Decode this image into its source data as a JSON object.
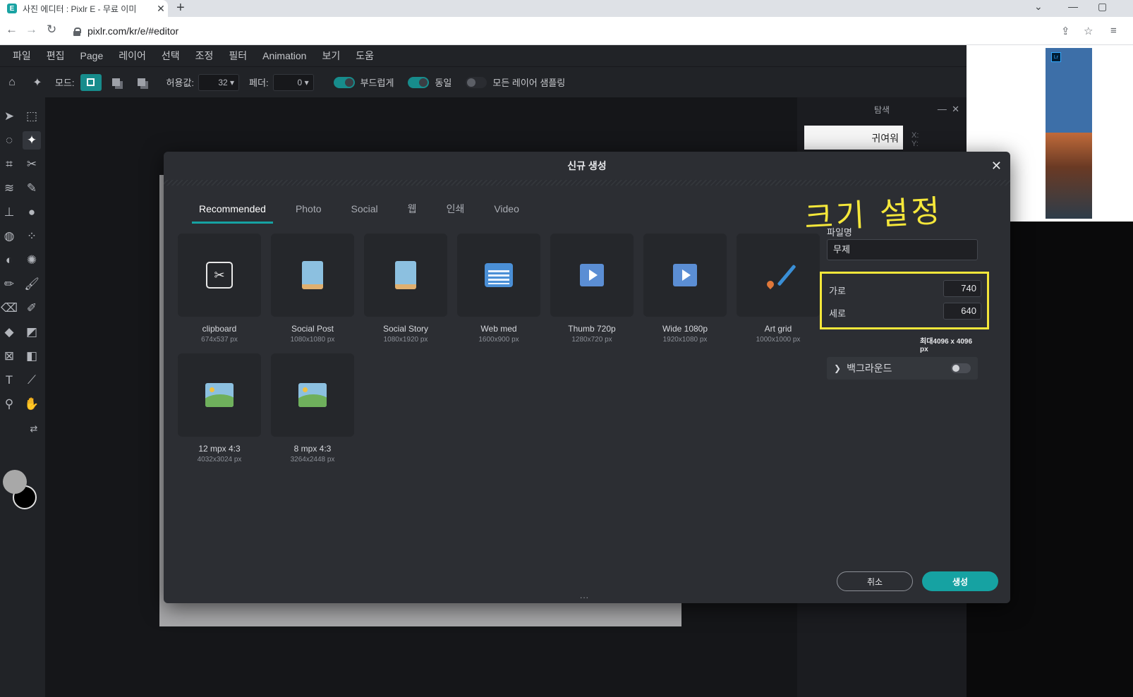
{
  "browser": {
    "tab_title": "사진 에디터 : Pixlr E - 무료 이미",
    "favicon": "E",
    "tab_close": "✕",
    "new_tab": "+",
    "url": "pixlr.com/kr/e/#editor",
    "icons": [
      "back-arrow-icon",
      "forward-arrow-icon",
      "reload-icon",
      "lock-icon",
      "share-icon",
      "star-icon",
      "reading-list-icon"
    ]
  },
  "menu": {
    "items": [
      "파일",
      "편집",
      "Page",
      "레이어",
      "선택",
      "조정",
      "필터",
      "Animation",
      "보기",
      "도움"
    ]
  },
  "toolbar": {
    "mode_label": "모드:",
    "tolerance_label": "허용값:",
    "tolerance_value": "32",
    "feather_label": "페더:",
    "feather_value": "0",
    "smooth_label": "부드럽게",
    "contiguous_label": "동일",
    "sample_all_label": "모든 레이어 샘플링"
  },
  "navigator": {
    "title": "탐색",
    "thumb_text": "귀여워",
    "x_label": "X:",
    "y_label": "Y:"
  },
  "ad": {
    "logo_text": "Lr"
  },
  "modal": {
    "title": "신규 생성",
    "close": "✕",
    "tabs": [
      "Recommended",
      "Photo",
      "Social",
      "웹",
      "인쇄",
      "Video"
    ],
    "active_tab": "Recommended",
    "presets": [
      {
        "name": "clipboard",
        "size": "674x537 px",
        "icon": "clipboard-icon"
      },
      {
        "name": "Social Post",
        "size": "1080x1080 px",
        "icon": "phone-icon"
      },
      {
        "name": "Social Story",
        "size": "1080x1920 px",
        "icon": "phone-icon"
      },
      {
        "name": "Web med",
        "size": "1600x900 px",
        "icon": "web-page-icon"
      },
      {
        "name": "Thumb 720p",
        "size": "1280x720 px",
        "icon": "play-icon"
      },
      {
        "name": "Wide 1080p",
        "size": "1920x1080 px",
        "icon": "play-icon"
      },
      {
        "name": "Art grid",
        "size": "1000x1000 px",
        "icon": "paintbrush-icon"
      },
      {
        "name": "12 mpx 4:3",
        "size": "4032x3024 px",
        "icon": "image-icon"
      },
      {
        "name": "8 mpx 4:3",
        "size": "3264x2448 px",
        "icon": "image-icon"
      }
    ],
    "annotation": "크기 설정",
    "filename_label": "파일명",
    "filename_value": "무제",
    "width_label": "가로",
    "width_value": "740",
    "height_label": "세로",
    "height_value": "640",
    "max_size": "최대4096 x 4096 px",
    "background_label": "백그라운드",
    "background_enabled": false,
    "cancel_label": "취소",
    "create_label": "생성",
    "more": "..."
  },
  "colors": {
    "accent": "#16a2a2",
    "annotation": "#f5e73a",
    "modal_bg": "#2c2e33",
    "app_bg": "#212327"
  }
}
